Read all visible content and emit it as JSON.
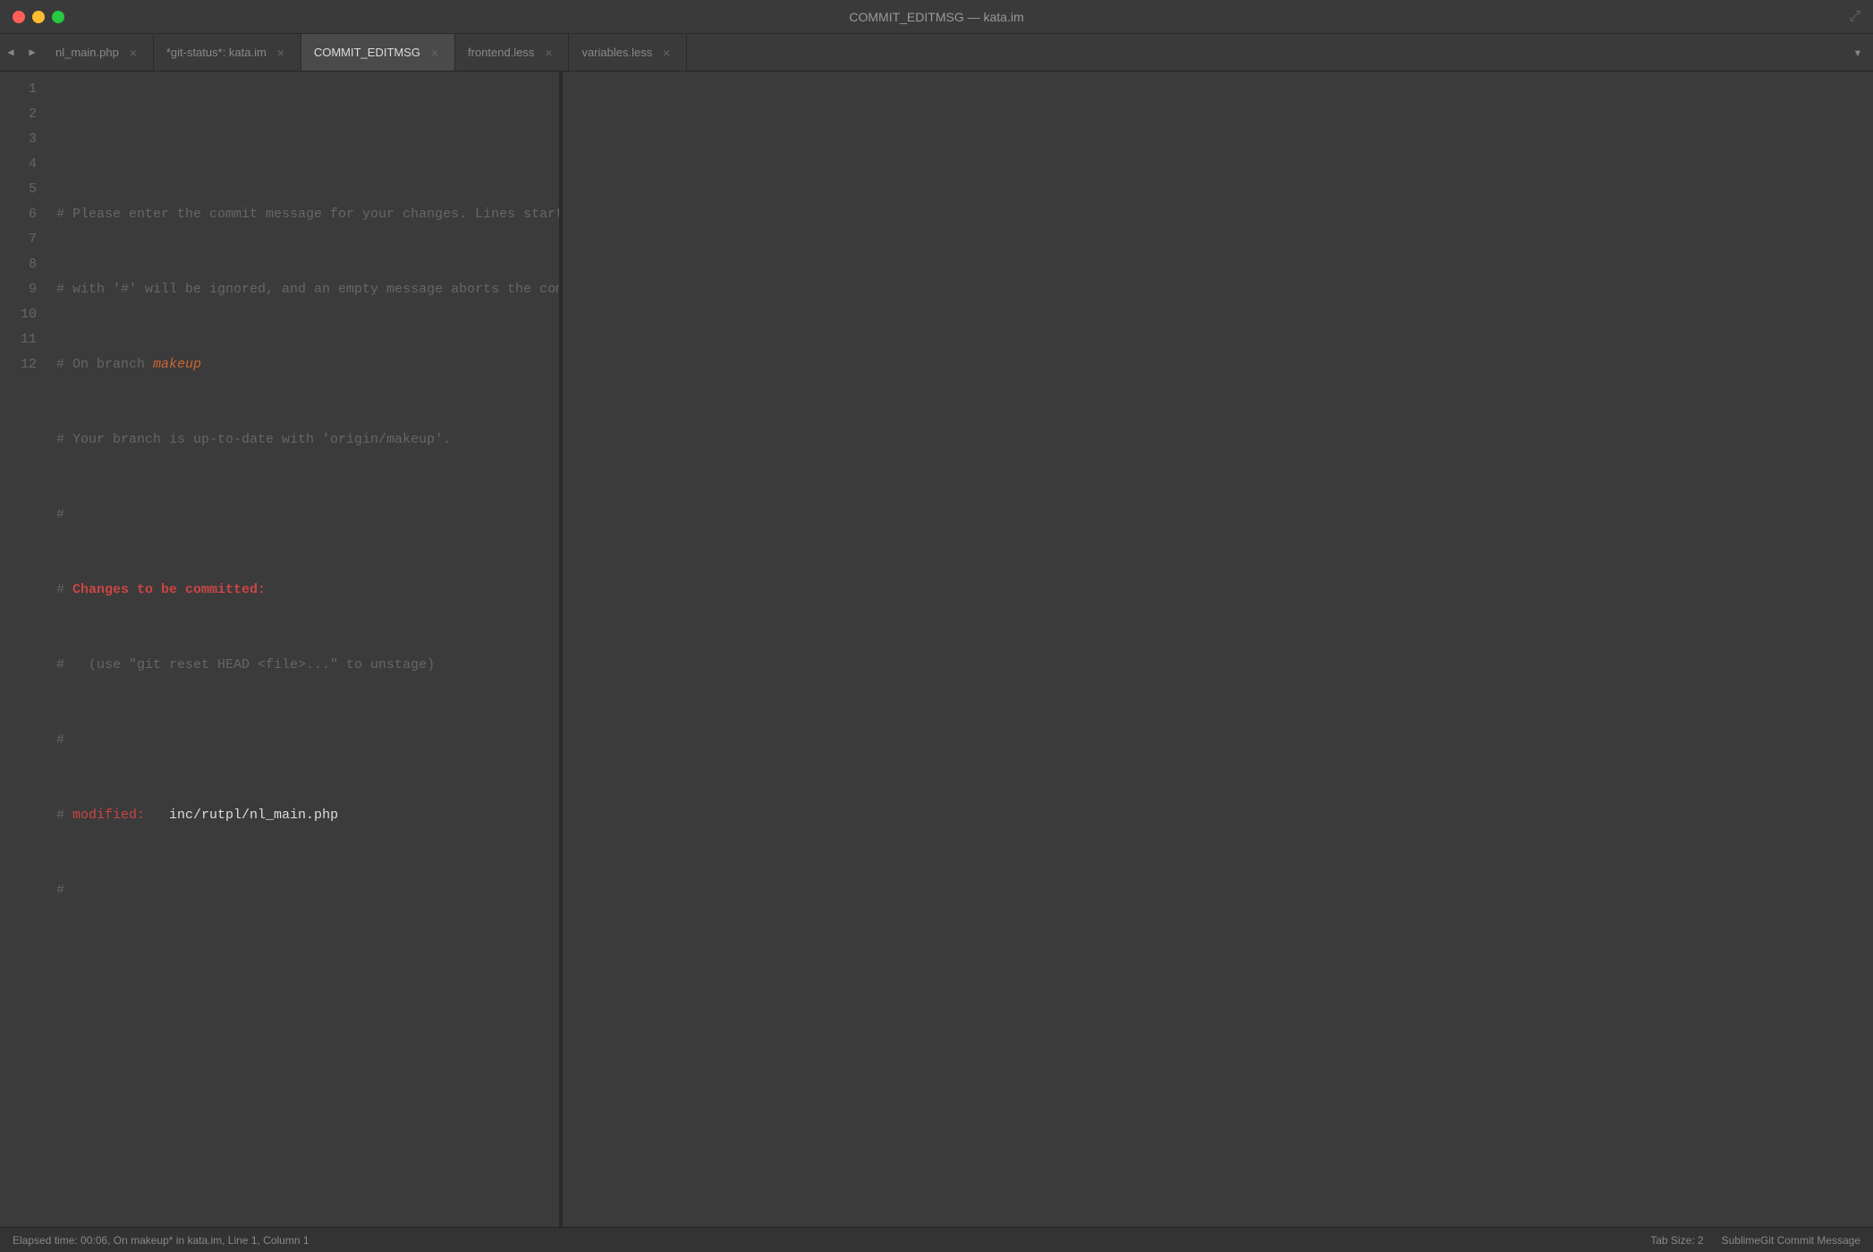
{
  "window": {
    "title": "COMMIT_EDITMSG — kata.im"
  },
  "titlebar": {
    "buttons": {
      "close": "close",
      "minimize": "minimize",
      "maximize": "maximize"
    }
  },
  "tabs": [
    {
      "id": "nl_main_php",
      "label": "nl_main.php",
      "active": false,
      "modified": false
    },
    {
      "id": "git_status",
      "label": "*git-status*: kata.im",
      "active": false,
      "modified": true
    },
    {
      "id": "commit_editmsg",
      "label": "COMMIT_EDITMSG",
      "active": true,
      "modified": false
    },
    {
      "id": "frontend_less",
      "label": "frontend.less",
      "active": false,
      "modified": false
    },
    {
      "id": "variables_less",
      "label": "variables.less",
      "active": false,
      "modified": false
    }
  ],
  "editor": {
    "lines": [
      {
        "num": 1,
        "content": "",
        "parts": []
      },
      {
        "num": 2,
        "content": "# Please enter the commit message for your changes. Lines starting",
        "type": "comment"
      },
      {
        "num": 3,
        "content": "# with '#' will be ignored, and an empty message aborts the commit.",
        "type": "comment"
      },
      {
        "num": 4,
        "content": "# On branch makeup",
        "type": "comment_branch",
        "prefix": "# On branch ",
        "branch": "makeup"
      },
      {
        "num": 5,
        "content": "# Your branch is up-to-date with 'origin/makeup'.",
        "type": "comment"
      },
      {
        "num": 6,
        "content": "#",
        "type": "comment"
      },
      {
        "num": 7,
        "content": "# Changes to be committed:",
        "type": "comment_header",
        "prefix": "# ",
        "header": "Changes to be committed:"
      },
      {
        "num": 8,
        "content": "#   (use \"git reset HEAD <file>...\" to unstage)",
        "type": "comment"
      },
      {
        "num": 9,
        "content": "#",
        "type": "comment"
      },
      {
        "num": 10,
        "content": "# modified:   inc/rutpl/nl_main.php",
        "type": "modified",
        "prefix": "# ",
        "label": "modified:",
        "path": "   inc/rutpl/nl_main.php"
      },
      {
        "num": 11,
        "content": "#",
        "type": "comment"
      },
      {
        "num": 12,
        "content": "",
        "type": "empty"
      }
    ]
  },
  "statusbar": {
    "left": "Elapsed time: 00:06, On makeup* in kata.im, Line 1, Column 1",
    "tab_size": "Tab Size: 2",
    "syntax": "SublimeGit Commit Message"
  }
}
